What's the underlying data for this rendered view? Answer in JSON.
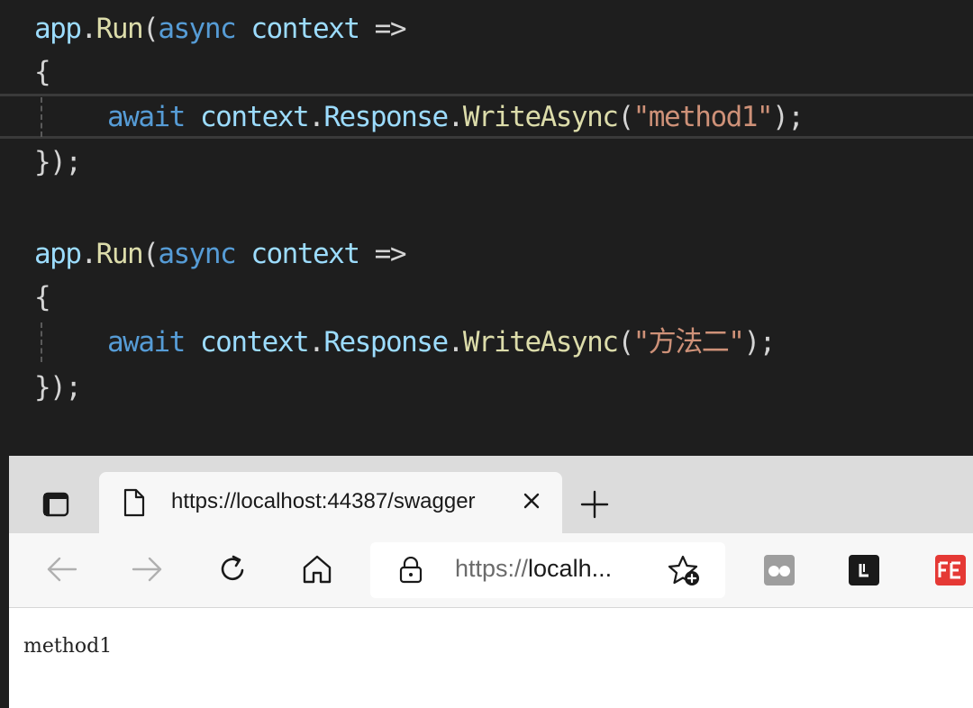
{
  "editor": {
    "block1": {
      "line1": {
        "app": "app",
        "dot": ".",
        "run": "Run",
        "paren": "(",
        "async": "async",
        "context": "context",
        "arrow": "=>"
      },
      "open": "{",
      "line3": {
        "await": "await",
        "context": "context",
        "dot1": ".",
        "response": "Response",
        "dot2": ".",
        "write": "WriteAsync",
        "open": "(",
        "str": "\"method1\"",
        "close": ");"
      },
      "close": "});"
    },
    "block2": {
      "line1": {
        "app": "app",
        "dot": ".",
        "run": "Run",
        "paren": "(",
        "async": "async",
        "context": "context",
        "arrow": "=>"
      },
      "open": "{",
      "line3": {
        "await": "await",
        "context": "context",
        "dot1": ".",
        "response": "Response",
        "dot2": ".",
        "write": "WriteAsync",
        "open": "(",
        "str": "\"方法二\"",
        "close": ");"
      },
      "close": "});"
    }
  },
  "browser": {
    "tab": {
      "title": "https://localhost:44387/swagger",
      "close_glyph": "✕"
    },
    "new_tab_glyph": "+",
    "address": {
      "protocol": "https://",
      "host": "localh...",
      "security_icon": "lock-icon",
      "favorite_icon": "add-favorite-icon"
    },
    "toolbar_icons": [
      "back-arrow-icon",
      "forward-arrow-icon",
      "refresh-icon",
      "home-icon"
    ],
    "extensions": [
      {
        "name": "mask-extension-icon",
        "color": "#9e9e9e"
      },
      {
        "name": "l-extension-icon",
        "label": "L",
        "color": "#1a1a1a"
      },
      {
        "name": "fe-extension-icon",
        "label": "FE",
        "color": "#e53935"
      }
    ],
    "page": {
      "content": "method1"
    }
  },
  "colors": {
    "keyword": "#569cd6",
    "identifier": "#9cdcfe",
    "method": "#dcdcaa",
    "string": "#ce9178",
    "editor_bg": "#1e1e1e"
  }
}
